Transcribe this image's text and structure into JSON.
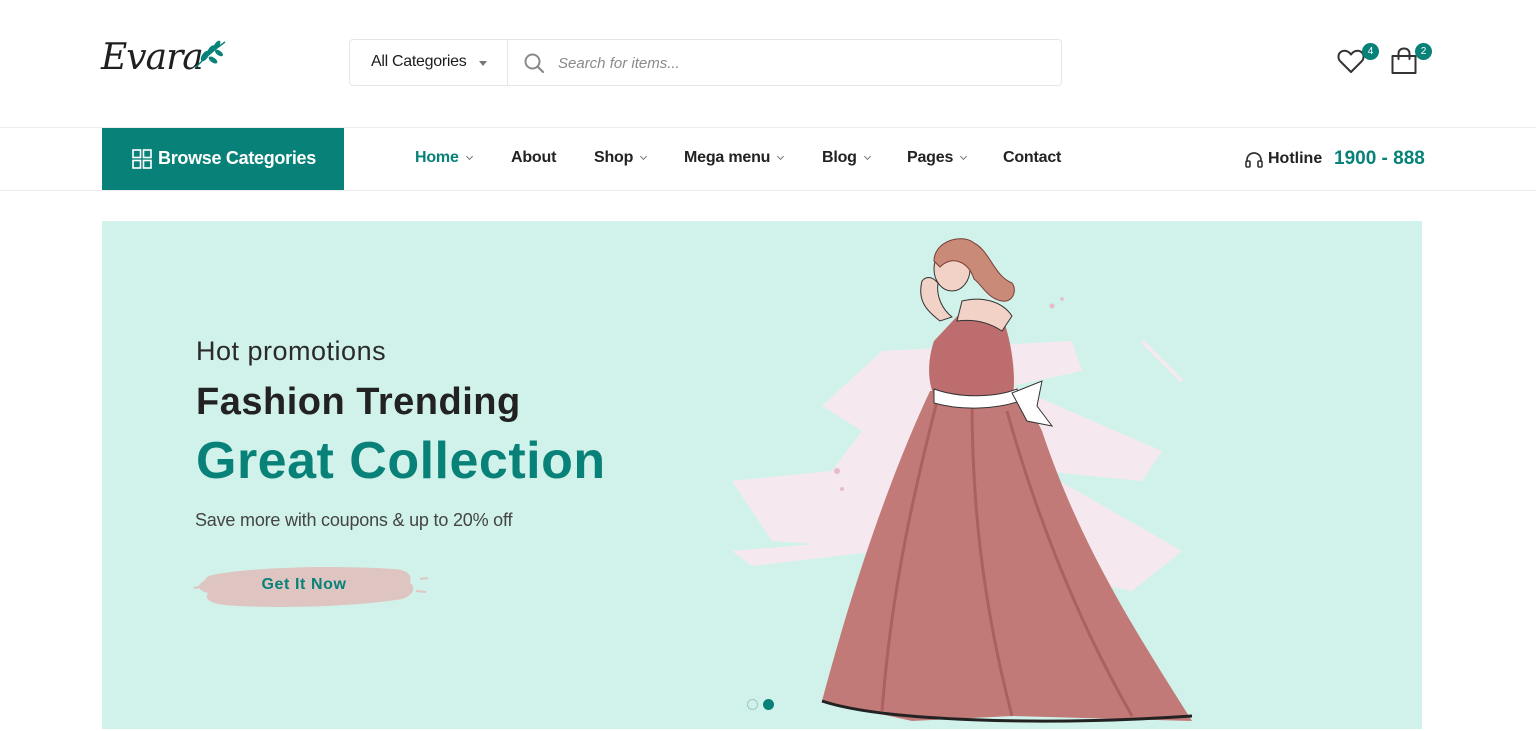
{
  "brand": {
    "name": "Evara"
  },
  "search": {
    "category_label": "All Categories",
    "placeholder": "Search for items..."
  },
  "header": {
    "wishlist_count": "4",
    "cart_count": "2"
  },
  "nav": {
    "browse_label": "Browse Categories",
    "items": [
      {
        "label": "Home",
        "active": true,
        "has_dropdown": true
      },
      {
        "label": "About",
        "active": false,
        "has_dropdown": false
      },
      {
        "label": "Shop",
        "active": false,
        "has_dropdown": true
      },
      {
        "label": "Mega menu",
        "active": false,
        "has_dropdown": true
      },
      {
        "label": "Blog",
        "active": false,
        "has_dropdown": true
      },
      {
        "label": "Pages",
        "active": false,
        "has_dropdown": true
      },
      {
        "label": "Contact",
        "active": false,
        "has_dropdown": false
      }
    ],
    "hotline_label": "Hotline",
    "hotline_number": "1900 - 888"
  },
  "hero": {
    "subtitle": "Hot promotions",
    "title": "Fashion Trending",
    "title_highlight": "Great Collection",
    "description": "Save more with coupons & up to 20% off",
    "cta_label": "Get It Now",
    "slides": 2,
    "active_slide": 2
  },
  "colors": {
    "accent": "#088178",
    "hero_bg": "#d1f2ea",
    "cta_brush": "#dfc5c2"
  },
  "icons": {
    "search": "search-icon",
    "wishlist": "heart-icon",
    "cart": "shopping-bag-icon",
    "browse": "grid-icon",
    "hotline": "headset-icon"
  }
}
